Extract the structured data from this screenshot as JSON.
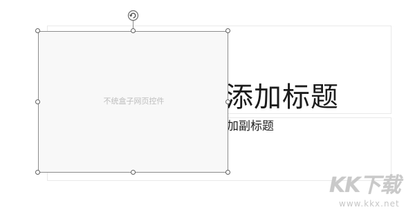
{
  "slide": {
    "title_text": "添加标题",
    "subtitle_text": "加副标题"
  },
  "control": {
    "label": "不统盒子网页控件",
    "background_color": "#f8f8f8",
    "border_color": "#8c8c8c"
  },
  "icons": {
    "rotate": "rotate-icon",
    "resize_handle": "resize-handle-icon"
  },
  "watermark": {
    "logo_text": "KK下载",
    "url_text": "www.kkx.net"
  }
}
